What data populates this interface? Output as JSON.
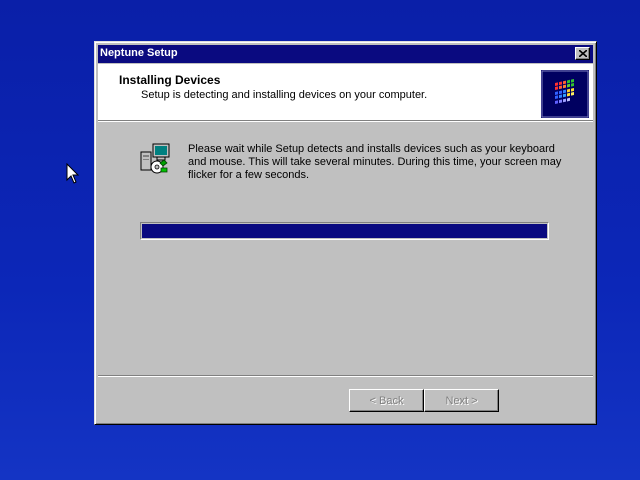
{
  "window": {
    "title": "Neptune Setup",
    "close_icon": "close-icon"
  },
  "header": {
    "title": "Installing Devices",
    "subtitle": "Setup is detecting and installing devices on your computer.",
    "logo_icon": "windows-flag-logo"
  },
  "content": {
    "icon": "computer-devices-setup-icon",
    "message": "Please wait while Setup detects and installs devices such as your keyboard and mouse.  This will take several minutes.  During this time, your screen may flicker for a few seconds."
  },
  "progress": {
    "percent": 100,
    "color": "#0a0a80"
  },
  "buttons": {
    "back_label": "< Back",
    "next_label": "Next >",
    "back_enabled": false,
    "next_enabled": false
  },
  "colors": {
    "desktop": "#0c27b8",
    "titlebar": "#0a0a80",
    "window_face": "#c0c0c0"
  },
  "cursor_icon": "arrow-cursor-icon"
}
